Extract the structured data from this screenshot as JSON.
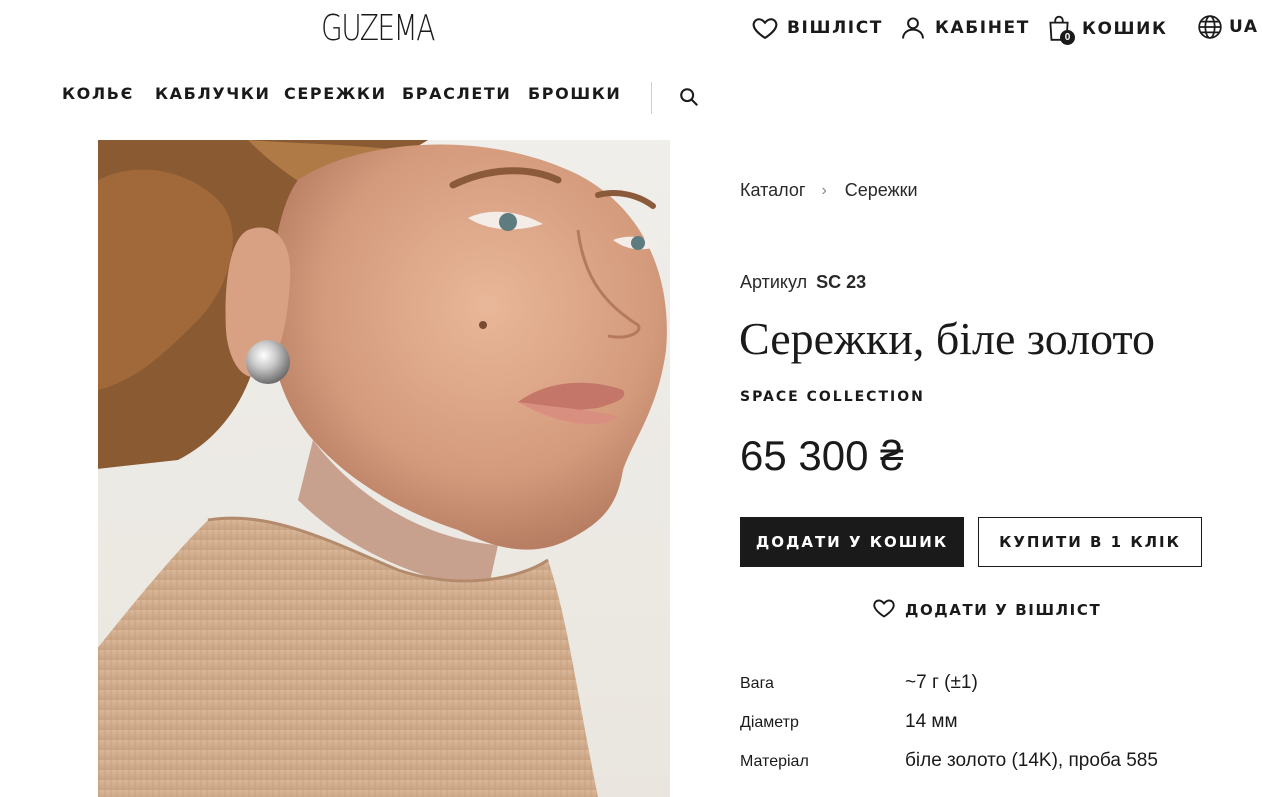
{
  "brand": {
    "logo_text": "GUZEMA"
  },
  "header": {
    "wishlist_label": "ВІШЛІСТ",
    "account_label": "КАБІНЕТ",
    "cart_label": "КОШИК",
    "cart_count": "0",
    "language": "UA",
    "icons": [
      "heart-icon",
      "user-icon",
      "bag-icon",
      "globe-icon",
      "search-icon"
    ]
  },
  "nav": {
    "items": [
      "КОЛЬЄ",
      "КАБЛУЧКИ",
      "СЕРЕЖКИ",
      "БРАСЛЕТИ",
      "БРОШКИ"
    ]
  },
  "breadcrumb": {
    "items": [
      "Каталог",
      "Сережки"
    ]
  },
  "product": {
    "sku_label": "Артикул",
    "sku": "SC 23",
    "title": "Сережки, біле золото",
    "collection": "SPACE COLLECTION",
    "price": "65 300 ₴",
    "add_to_cart_label": "ДОДАТИ У КОШИК",
    "buy_one_click_label": "КУПИТИ В 1 КЛІК",
    "add_to_wishlist_label": "ДОДАТИ У ВІШЛІСТ",
    "specs": [
      {
        "label": "Вага",
        "value": "~7 г (±1)"
      },
      {
        "label": "Діаметр",
        "value": "14 мм"
      },
      {
        "label": "Матеріал",
        "value": "біле золото (14K), проба 585"
      }
    ]
  },
  "colors": {
    "text": "#1a1a1a",
    "button_dark": "#1a1a1a",
    "background": "#ffffff"
  }
}
